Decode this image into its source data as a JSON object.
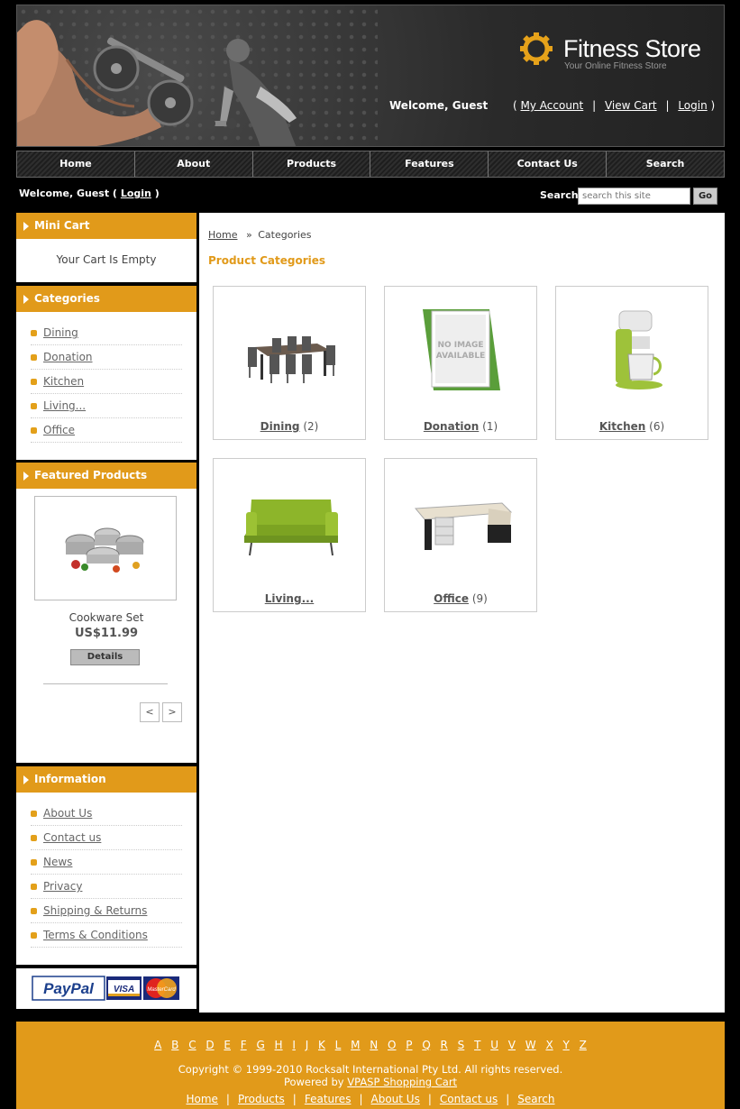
{
  "header": {
    "store_name": "Fitness Store",
    "tagline": "Your Online Fitness Store",
    "welcome": "Welcome, Guest",
    "open_paren": "(",
    "close_paren": ")",
    "sep": "|",
    "my_account": "My Account",
    "view_cart": "View Cart",
    "login": "Login"
  },
  "nav": {
    "items": [
      "Home",
      "About",
      "Products",
      "Features",
      "Contact Us",
      "Search"
    ]
  },
  "subbar": {
    "welcome_prefix": "Welcome, Guest (",
    "login": "Login",
    "welcome_suffix": ")",
    "search_label": "Search",
    "search_placeholder": "search this site",
    "go": "Go"
  },
  "sidebar": {
    "mini_cart": {
      "title": "Mini Cart",
      "empty_text": "Your Cart Is Empty"
    },
    "categories": {
      "title": "Categories",
      "items": [
        "Dining",
        "Donation",
        "Kitchen",
        "Living...",
        "Office"
      ]
    },
    "featured": {
      "title": "Featured Products",
      "product_name": "Cookware Set",
      "price": "US$11.99",
      "details": "Details",
      "prev": "<",
      "next": ">"
    },
    "information": {
      "title": "Information",
      "items": [
        "About Us",
        "Contact us",
        "News",
        "Privacy",
        "Shipping & Returns",
        "Terms & Conditions"
      ]
    },
    "payment": {
      "paypal": "PayPal",
      "visa": "VISA",
      "mastercard": "MasterCard"
    }
  },
  "main": {
    "breadcrumb_home": "Home",
    "breadcrumb_sep": "»",
    "breadcrumb_current": "Categories",
    "title": "Product Categories",
    "no_image_line1": "NO IMAGE",
    "no_image_line2": "AVAILABLE",
    "categories": [
      {
        "name": "Dining",
        "count": "(2)"
      },
      {
        "name": "Donation",
        "count": "(1)"
      },
      {
        "name": "Kitchen",
        "count": "(6)"
      },
      {
        "name": "Living...",
        "count": ""
      },
      {
        "name": "Office",
        "count": "(9)"
      }
    ]
  },
  "footer": {
    "letters": [
      "A",
      "B",
      "C",
      "D",
      "E",
      "F",
      "G",
      "H",
      "I",
      "J",
      "K",
      "L",
      "M",
      "N",
      "O",
      "P",
      "Q",
      "R",
      "S",
      "T",
      "U",
      "V",
      "W",
      "X",
      "Y",
      "Z"
    ],
    "copyright": "Copyright © 1999-2010 Rocksalt International Pty Ltd. All rights reserved.",
    "powered_prefix": "Powered by",
    "powered_link": "VPASP Shopping Cart",
    "links": [
      "Home",
      "Products",
      "Features",
      "About Us",
      "Contact us",
      "Search"
    ],
    "sep": "|"
  },
  "colors": {
    "accent": "#e19a1a",
    "background": "#000000",
    "panel": "#ffffff"
  }
}
